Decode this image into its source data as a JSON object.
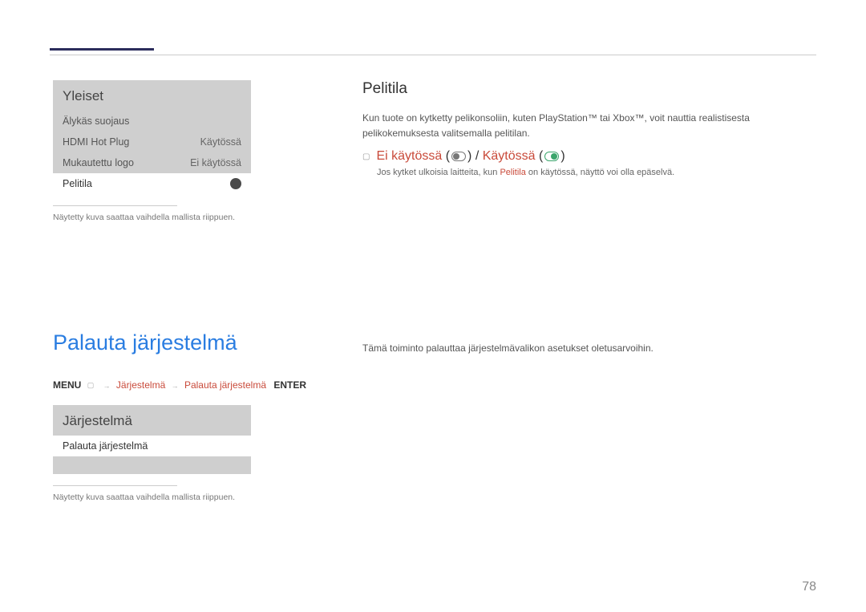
{
  "panel1": {
    "title": "Yleiset",
    "row1": {
      "label": "Älykäs suojaus"
    },
    "row2": {
      "label": "HDMI Hot Plug",
      "value": "Käytössä"
    },
    "row3": {
      "label": "Mukautettu logo",
      "value": "Ei käytössä"
    },
    "row4": {
      "label": "Pelitila"
    }
  },
  "caption1": "Näytetty kuva saattaa vaihdella mallista riippuen.",
  "right1": {
    "heading": "Pelitila",
    "p1": "Kun tuote on kytketty pelikonsoliin, kuten PlayStation™ tai Xbox™, voit nauttia realistisesta pelikokemuksesta valitsemalla pelitilan.",
    "opt1": "Ei käytössä",
    "opt2": "Käytössä",
    "note_pre": "Jos kytket ulkoisia laitteita, kun ",
    "note_red": "Pelitila",
    "note_post": " on käytössä, näyttö voi olla epäselvä."
  },
  "section2": {
    "heading": "Palauta järjestelmä",
    "menu": "MENU",
    "crumb1": "Järjestelmä",
    "crumb2": "Palauta järjestelmä",
    "enter": "ENTER",
    "panel_title": "Järjestelmä",
    "panel_item": "Palauta järjestelmä",
    "caption": "Näytetty kuva saattaa vaihdella mallista riippuen.",
    "right_text": "Tämä toiminto palauttaa järjestelmävalikon asetukset oletusarvoihin."
  },
  "page": "78"
}
